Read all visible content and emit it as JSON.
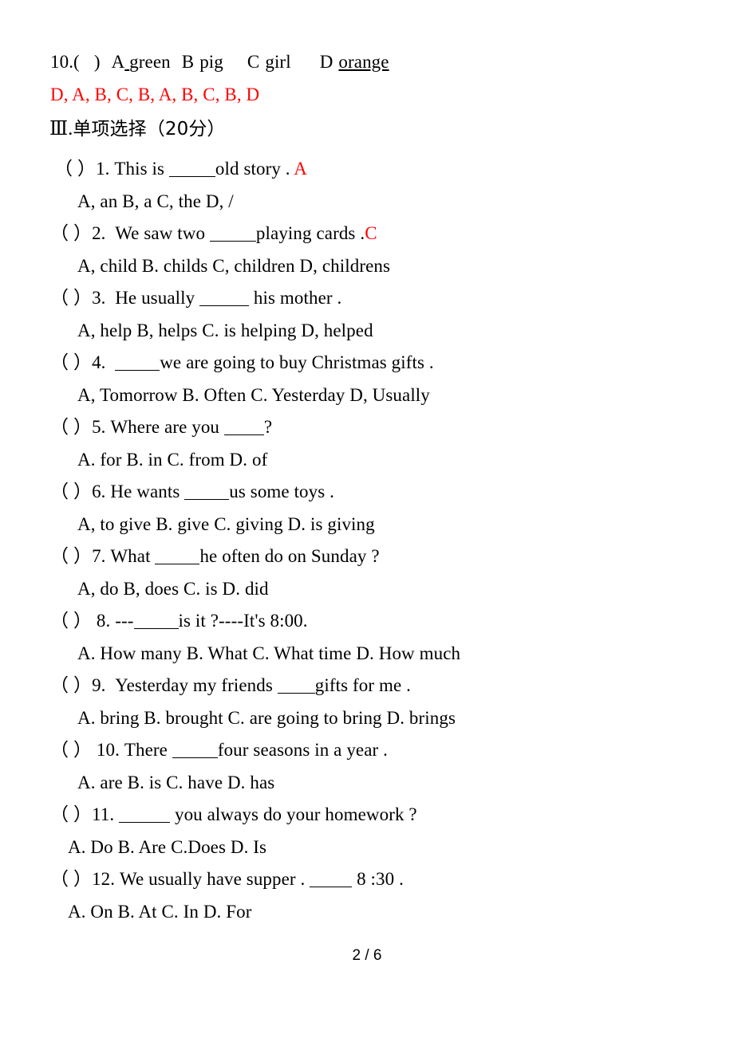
{
  "document": {
    "type": "english-exam-paper",
    "page_label": "2 / 6",
    "text_color": "#000000",
    "answer_color": "#ff0000",
    "background": "#ffffff"
  },
  "leftover_question": {
    "number": "10.(",
    "close_paren": ")",
    "options": [
      {
        "letter": "A",
        "text": "green"
      },
      {
        "letter": "B",
        "text": "pig"
      },
      {
        "letter": "C",
        "text": "girl"
      },
      {
        "letter": "D",
        "text": "orange"
      }
    ]
  },
  "answer_key": {
    "text": "D, A, B, C, B, A, B, C, B, D"
  },
  "section": {
    "numeral": "Ⅲ.",
    "title_cjk": "单项选择（20分）"
  },
  "questions": [
    {
      "bracket": "（ ）",
      "number": "1.",
      "stem_before": "This is ",
      "stem_after": "old story . ",
      "answer": "A",
      "options_line": "A, an    B, a     C, the  D, /"
    },
    {
      "bracket": "（ ）",
      "number": "2.",
      "stem_before": "We saw two ",
      "stem_after": "playing cards .",
      "answer": "C",
      "options_line": "A, child   B. childs   C, children   D, childrens"
    },
    {
      "bracket": "（ ）",
      "number": "3.",
      "stem_before": "He usually ",
      "stem_after": " his mother .",
      "answer": "",
      "options_line": "A, help  B, helps   C. is helping   D, helped"
    },
    {
      "bracket": "（ ）",
      "number": "4.",
      "stem_before": "",
      "stem_after": "we are going to buy Christmas gifts .",
      "answer": "",
      "options_line": "A, Tomorrow   B. Often   C. Yesterday   D, Usually"
    },
    {
      "bracket": "（ ）",
      "number": "5.",
      "stem_before": "Where are you ",
      "stem_after": "?",
      "answer": "",
      "options_line": "A. for   B. in C. from   D. of"
    },
    {
      "bracket": "（ ）",
      "number": "6.",
      "stem_before": "He wants ",
      "stem_after": "us some toys .",
      "answer": "",
      "options_line": "A, to give B. give C. giving  D. is giving"
    },
    {
      "bracket": "（ ）",
      "number": "7.",
      "stem_before": "What ",
      "stem_after": "he often do on Sunday ?",
      "answer": "",
      "options_line": "A, do B, does C. is  D. did"
    },
    {
      "bracket": "（ ）",
      "number": "8.",
      "stem_before": "---",
      "stem_after": "is it ?----It's 8:00.",
      "answer": "",
      "options_line": "A.  How many B. What C. What time  D. How much"
    },
    {
      "bracket": "（ ）",
      "number": "9.",
      "stem_before": "Yesterday my friends ",
      "stem_after": "gifts for me .",
      "answer": "",
      "options_line": "A.  bring B. brought C. are going to bring   D. brings"
    },
    {
      "bracket": "（ ）",
      "number": "10.",
      "stem_before": "There ",
      "stem_after": "four seasons in a year .",
      "answer": "",
      "options_line": "A. are   B. is  C. have  D. has"
    },
    {
      "bracket": "（ ）",
      "number": "11.",
      "stem_before": "",
      "stem_after": " you always do your homework ?",
      "answer": "",
      "options_line": "A. Do   B. Are  C.Does  D. Is"
    },
    {
      "bracket": "（ ）",
      "number": "12.",
      "stem_before": "We usually have supper . ",
      "stem_after": " 8 :30 .",
      "answer": "",
      "options_line": "A. On    B. At    C. In   D. For"
    }
  ]
}
